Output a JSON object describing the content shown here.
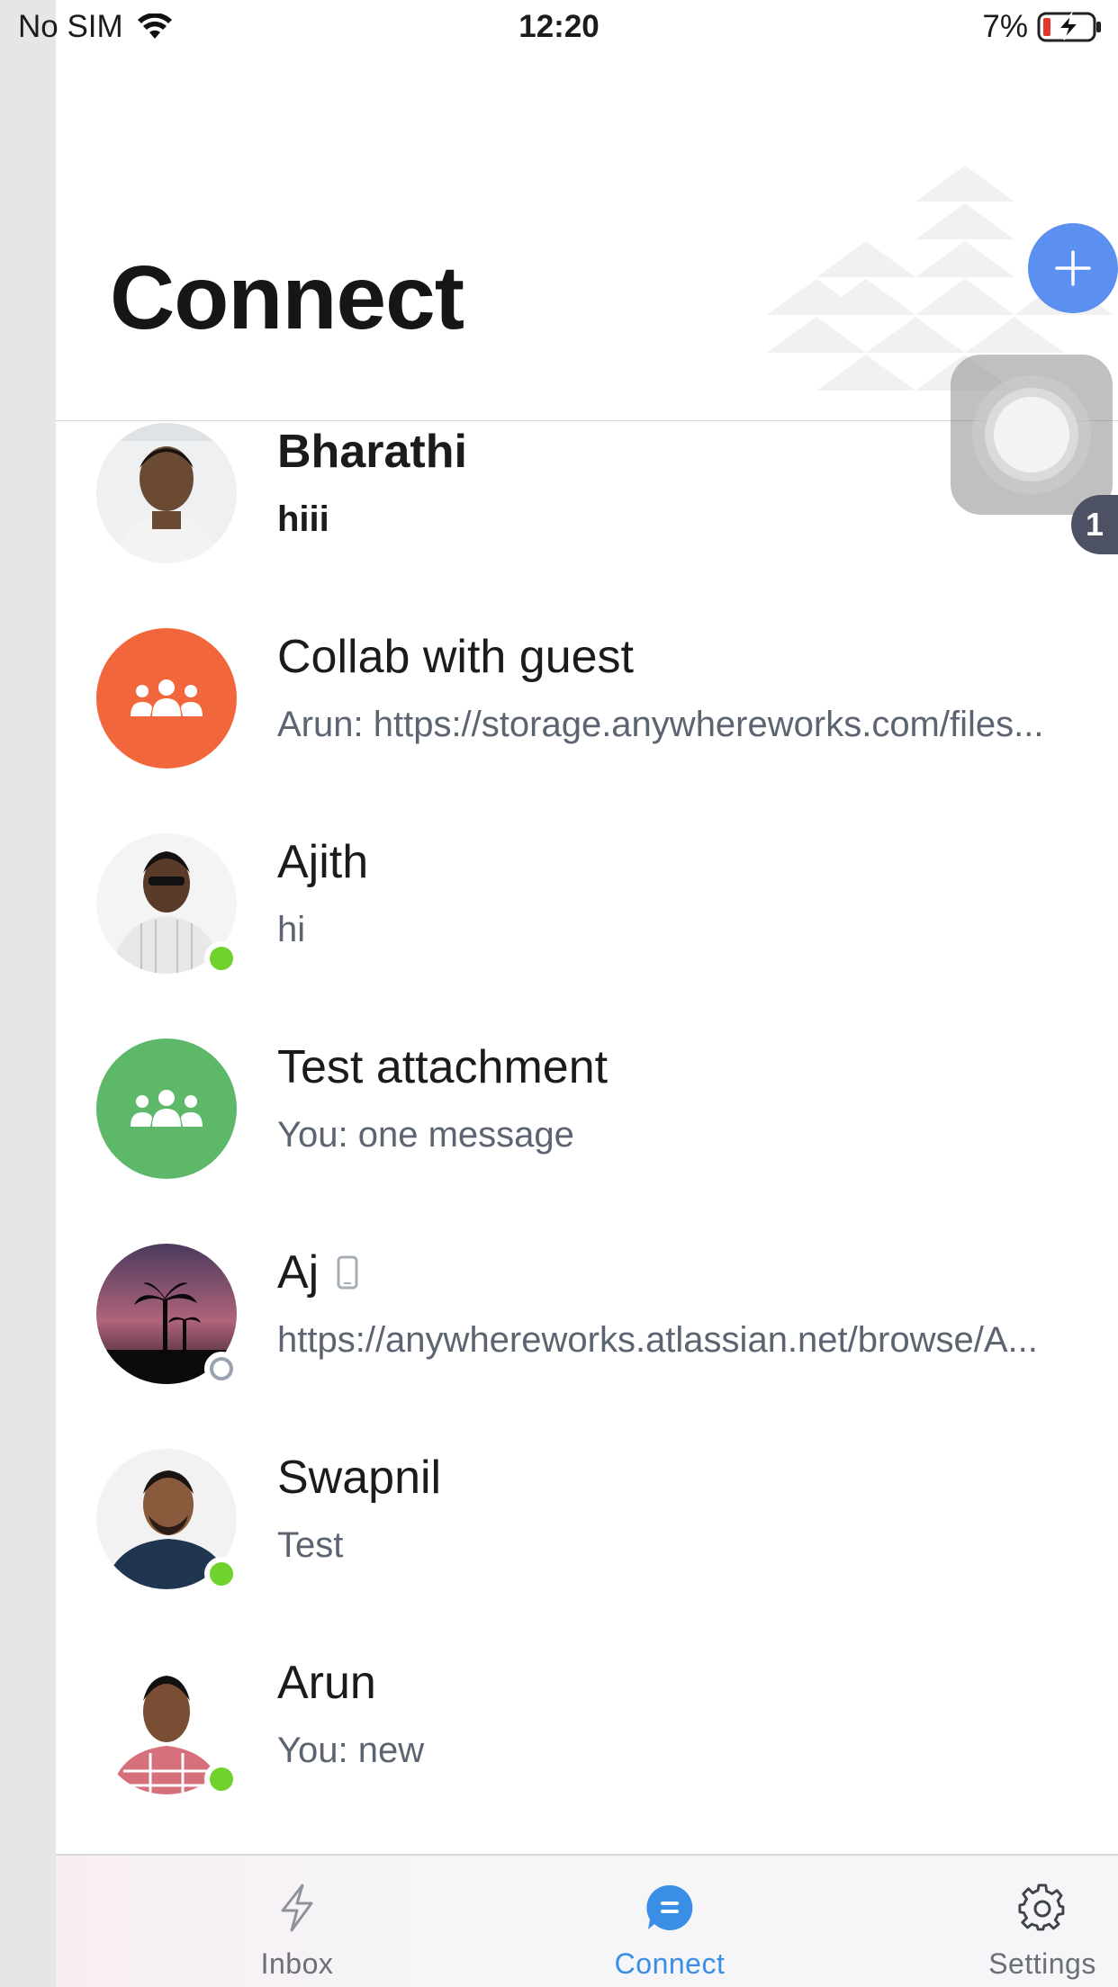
{
  "status_bar": {
    "carrier": "No SIM",
    "time": "12:20",
    "battery": "7%"
  },
  "header": {
    "title": "Connect"
  },
  "floating": {
    "unread_count": "1"
  },
  "chats": [
    {
      "name": "Bharathi",
      "preview": "hiii",
      "unread": true,
      "presence": "none"
    },
    {
      "name": "Collab with guest",
      "preview": "Arun: https://storage.anywhereworks.com/files...",
      "group_color": "#f2663b"
    },
    {
      "name": "Ajith",
      "preview": "hi",
      "presence": "online"
    },
    {
      "name": "Test attachment",
      "preview": "You: one message",
      "group_color": "#5db86a"
    },
    {
      "name": "Aj",
      "preview": "https://anywhereworks.atlassian.net/browse/A...",
      "presence": "offline",
      "name_icon": "mobile-device-icon"
    },
    {
      "name": "Swapnil",
      "preview": "Test",
      "presence": "online"
    },
    {
      "name": "Arun",
      "preview": "You: new",
      "presence": "online"
    }
  ],
  "tabs": [
    {
      "label": "Inbox",
      "icon": "lightning-icon",
      "active": false
    },
    {
      "label": "Connect",
      "icon": "chat-bubble-icon",
      "active": true
    },
    {
      "label": "Settings",
      "icon": "gear-icon",
      "active": false
    }
  ],
  "colors": {
    "accent": "#3a8ee6",
    "add_button": "#5b8ff0",
    "online": "#6fd22d"
  }
}
